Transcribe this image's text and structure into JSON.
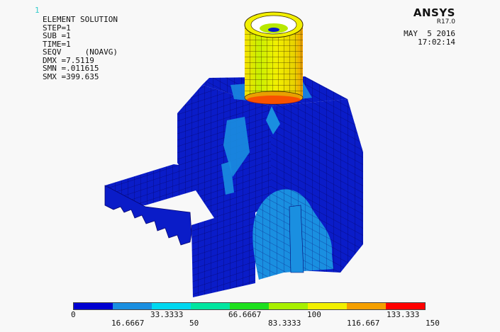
{
  "window_number": "1",
  "brand": {
    "name": "ANSYS",
    "version": "R17.0"
  },
  "info_lines": [
    "ELEMENT SOLUTION",
    "",
    "STEP=1",
    "SUB =1",
    "TIME=1",
    "SEQV     (NOAVG)",
    "DMX =7.5119",
    "SMN =.011615",
    "SMX =399.635"
  ],
  "datetime": {
    "date": "MAY  5 2016",
    "time": "17:02:14"
  },
  "legend": {
    "colors": [
      "#0000d0",
      "#1a8fe0",
      "#00d8f0",
      "#00e6a0",
      "#1ee01e",
      "#a8f000",
      "#f2f000",
      "#f5a000",
      "#ff0000"
    ],
    "ticks_top": [
      "0",
      "33.3333",
      "66.6667",
      "100",
      "133.333"
    ],
    "ticks_bottom": [
      "16.6667",
      "50",
      "83.3333",
      "116.667",
      "150"
    ]
  },
  "colors": {
    "mesh_dark": "#0a0a8c",
    "model_base": "#0a1cc8",
    "background": "#f8f8f8"
  }
}
